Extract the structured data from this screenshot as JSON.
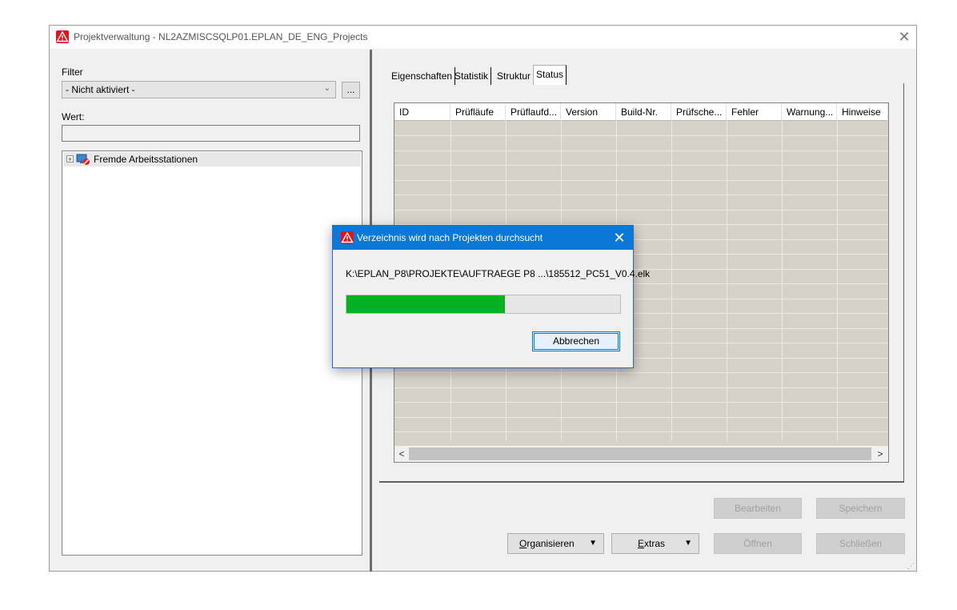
{
  "window": {
    "title": "Projektverwaltung - NL2AZMISCSQLP01.EPLAN_DE_ENG_Projects",
    "close_glyph": "✕",
    "icon": "eplan-warning-icon"
  },
  "left_panel": {
    "filter_label": "Filter",
    "filter_value": "- Nicht aktiviert -",
    "filter_more_button": "...",
    "value_label": "Wert:",
    "value_input": "",
    "tree": {
      "root": {
        "label": "Fremde Arbeitsstationen",
        "expand_glyph": "+",
        "icon": "workstation-blocked-icon"
      }
    }
  },
  "tabs": [
    {
      "label": "Eigenschaften"
    },
    {
      "label": "Statistik"
    },
    {
      "label": "Struktur"
    },
    {
      "label": "Status",
      "active": true
    }
  ],
  "grid": {
    "columns": [
      "ID",
      "Prüfläufe",
      "Prüflaufd...",
      "Version",
      "Build-Nr.",
      "Prüfsche...",
      "Fehler",
      "Warnung...",
      "Hinweise"
    ],
    "rows": [],
    "scroll_left": "<",
    "scroll_right": ">"
  },
  "buttons": {
    "bearbeiten": "Bearbeiten",
    "speichern": "Speichern",
    "organisieren_accel": "O",
    "organisieren_rest": "rganisieren",
    "extras_accel": "E",
    "extras_rest": "xtras",
    "oeffnen": "Öffnen",
    "schliessen": "Schließen",
    "dropdown_glyph": "▼"
  },
  "dialog": {
    "title": "Verzeichnis wird nach Projekten durchsucht",
    "close_glyph": "✕",
    "path": "K:\\EPLAN_P8\\PROJEKTE\\AUFTRAEGE P8 ...\\185512_PC51_V0.4.elk",
    "progress": 0.58,
    "cancel_button": "Abbrechen"
  },
  "colors": {
    "progress_fill": "#06b025",
    "dialog_titlebar": "#0a78d7",
    "app_icon": "#e0141e",
    "grid_background": "#d6d2ca"
  }
}
